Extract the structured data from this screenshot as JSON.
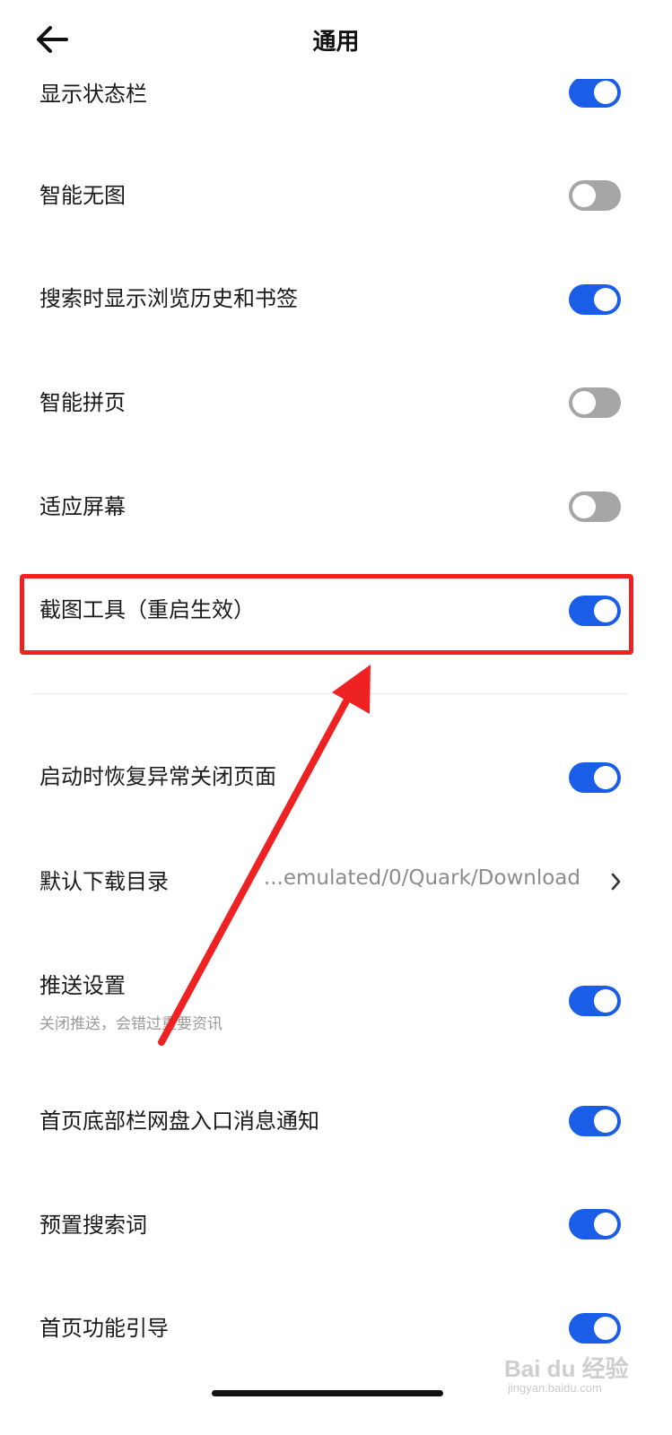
{
  "header": {
    "title": "通用"
  },
  "settings": [
    {
      "label": "显示状态栏",
      "on": true
    },
    {
      "label": "智能无图",
      "on": false
    },
    {
      "label": "搜索时显示浏览历史和书签",
      "on": true
    },
    {
      "label": "智能拼页",
      "on": false
    },
    {
      "label": "适应屏幕",
      "on": false
    },
    {
      "label": "截图工具（重启生效）",
      "on": true
    },
    {
      "label": "启动时恢复异常关闭页面",
      "on": true
    },
    {
      "label": "默认下载目录",
      "value": "...emulated/0/Quark/Download"
    },
    {
      "label": "推送设置",
      "sublabel": "关闭推送，会错过重要资讯",
      "on": true
    },
    {
      "label": "首页底部栏网盘入口消息通知",
      "on": true
    },
    {
      "label": "预置搜索词",
      "on": true
    },
    {
      "label": "首页功能引导",
      "on": true
    }
  ],
  "colors": {
    "toggle_on": "#1a5ee8",
    "toggle_off": "#a6a6a6",
    "highlight": "#ee2222"
  },
  "watermark": {
    "text": "Bai du 经验",
    "url": "jingyan.baidu.com"
  }
}
